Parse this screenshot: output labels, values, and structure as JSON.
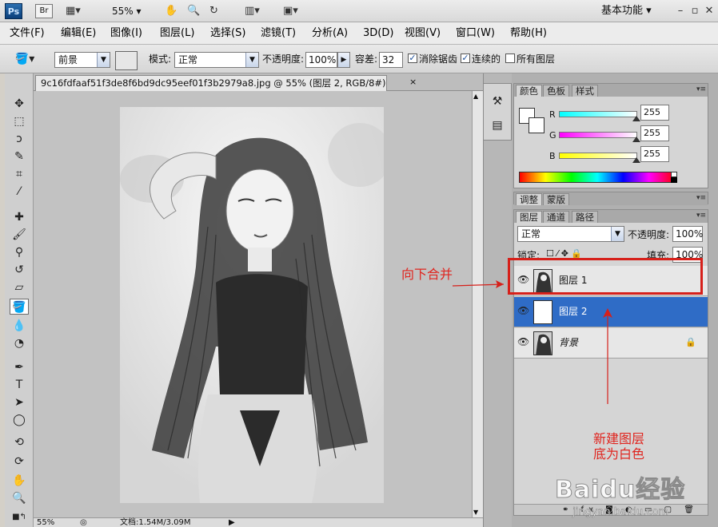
{
  "app": {
    "logo": "Ps",
    "bridge": "Br",
    "zoom": "55%",
    "workspace": "基本功能"
  },
  "menu": [
    "文件(F)",
    "编辑(E)",
    "图像(I)",
    "图层(L)",
    "选择(S)",
    "滤镜(T)",
    "分析(A)",
    "3D(D)",
    "视图(V)",
    "窗口(W)",
    "帮助(H)"
  ],
  "options": {
    "fill_source": "前景",
    "mode_label": "模式:",
    "mode_value": "正常",
    "opacity_label": "不透明度:",
    "opacity_value": "100%",
    "tolerance_label": "容差:",
    "tolerance_value": "32",
    "antialias_label": "消除锯齿",
    "contiguous_label": "连续的",
    "all_layers_label": "所有图层"
  },
  "document": {
    "tab_title": "9c16fdfaaf51f3de8f6bd9dc95eef01f3b2979a8.jpg @ 55% (图层 2, RGB/8#) *",
    "close": "×",
    "status_zoom": "55%",
    "status_doc": "文档:1.54M/3.09M"
  },
  "color_panel": {
    "tabs": [
      "颜色",
      "色板",
      "样式"
    ],
    "r_label": "R",
    "g_label": "G",
    "b_label": "B",
    "r_value": "255",
    "g_value": "255",
    "b_value": "255"
  },
  "adjust_panel": {
    "tabs": [
      "调整",
      "蒙版"
    ]
  },
  "layers_panel": {
    "tabs": [
      "图层",
      "通道",
      "路径"
    ],
    "blend_mode": "正常",
    "opacity_label": "不透明度:",
    "opacity_value": "100%",
    "lock_label": "锁定:",
    "fill_label": "填充:",
    "fill_value": "100%",
    "layers": [
      {
        "name": "图层 1",
        "selected": false
      },
      {
        "name": "图层 2",
        "selected": true
      },
      {
        "name": "背景",
        "selected": false
      }
    ]
  },
  "annotations": {
    "merge_down": "向下合并",
    "new_layer_line1": "新建图层",
    "new_layer_line2": "底为白色"
  },
  "watermark": {
    "main": "Baidu经验",
    "sub": "jingyan.baidu.com"
  },
  "colors": {
    "selected_layer": "#2f6cc6",
    "annotation": "#e0251f"
  }
}
